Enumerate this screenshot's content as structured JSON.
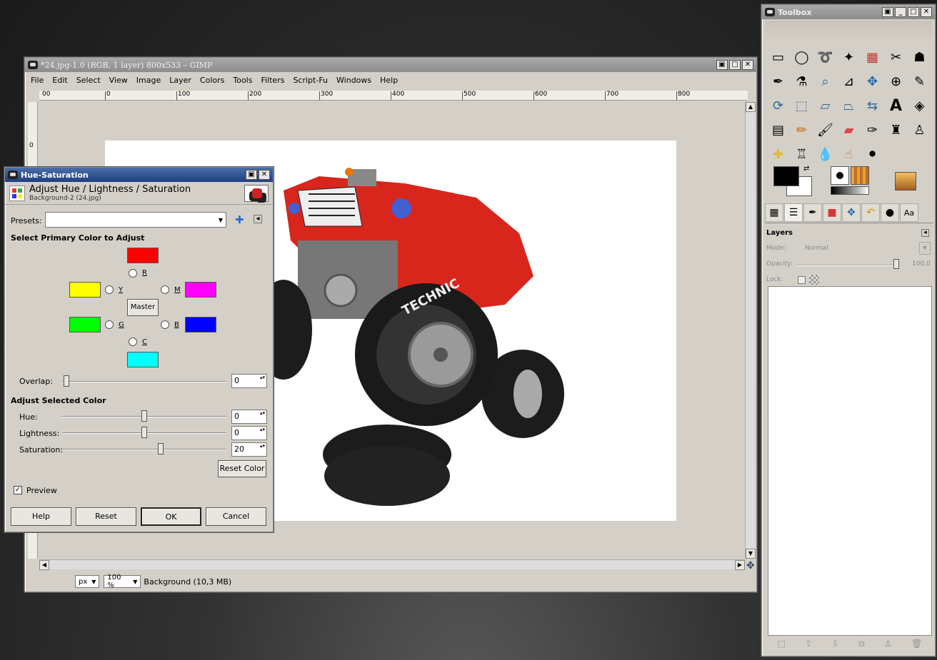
{
  "main_window": {
    "title": "*24.jpg-1.0 (RGB, 1 layer) 800x533 – GIMP",
    "menu": [
      "File",
      "Edit",
      "Select",
      "View",
      "Image",
      "Layer",
      "Colors",
      "Tools",
      "Filters",
      "Script-Fu",
      "Windows",
      "Help"
    ],
    "ruler_labels": [
      "00",
      "0",
      "100",
      "200",
      "300",
      "400",
      "500",
      "600",
      "700",
      "800"
    ],
    "vruler_label": "0",
    "unit": "px",
    "zoom": "100 %",
    "status": "Background (10,3 MB)"
  },
  "dialog": {
    "title": "Hue-Saturation",
    "heading": "Adjust Hue / Lightness / Saturation",
    "subheading": "Background-2 (24.jpg)",
    "presets_label": "Presets:",
    "presets_value": "",
    "primary_label": "Select Primary Color to Adjust",
    "colors": {
      "R": "#ff0000",
      "Y": "#ffff00",
      "M": "#ff00ff",
      "G": "#00ff00",
      "B": "#0000ff",
      "C": "#00ffff"
    },
    "radio_labels": {
      "R": "R",
      "Y": "Y",
      "M": "M",
      "G": "G",
      "B": "B",
      "C": "C"
    },
    "master_label": "Master",
    "overlap_label": "Overlap:",
    "overlap_value": "0",
    "adjust_label": "Adjust Selected Color",
    "hue_label": "Hue:",
    "hue_value": "0",
    "lightness_label": "Lightness:",
    "lightness_value": "0",
    "saturation_label": "Saturation:",
    "saturation_value": "20",
    "reset_color_label": "Reset Color",
    "preview_label": "Preview",
    "preview_checked": true,
    "buttons": {
      "help": "Help",
      "reset": "Reset",
      "ok": "OK",
      "cancel": "Cancel"
    }
  },
  "toolbox": {
    "title": "Toolbox",
    "tools": [
      "rect-select",
      "ellipse-select",
      "free-select",
      "fuzzy-select",
      "color-select",
      "scissors",
      "foreground-select",
      "paths",
      "color-picker",
      "zoom",
      "measure",
      "move",
      "align",
      "crop",
      "rotate",
      "scale",
      "shear",
      "perspective",
      "flip",
      "text",
      "bucket-fill",
      "blend",
      "pencil",
      "paintbrush",
      "eraser",
      "airbrush",
      "ink",
      "clone",
      "heal",
      "perspective-clone",
      "blur",
      "smudge",
      "dodge-burn"
    ],
    "fg_color": "#000000",
    "bg_color": "#ffffff"
  },
  "layers": {
    "title": "Layers",
    "mode_label": "Mode:",
    "mode_value": "Normal",
    "opacity_label": "Opacity:",
    "opacity_value": "100,0",
    "lock_label": "Lock:"
  }
}
